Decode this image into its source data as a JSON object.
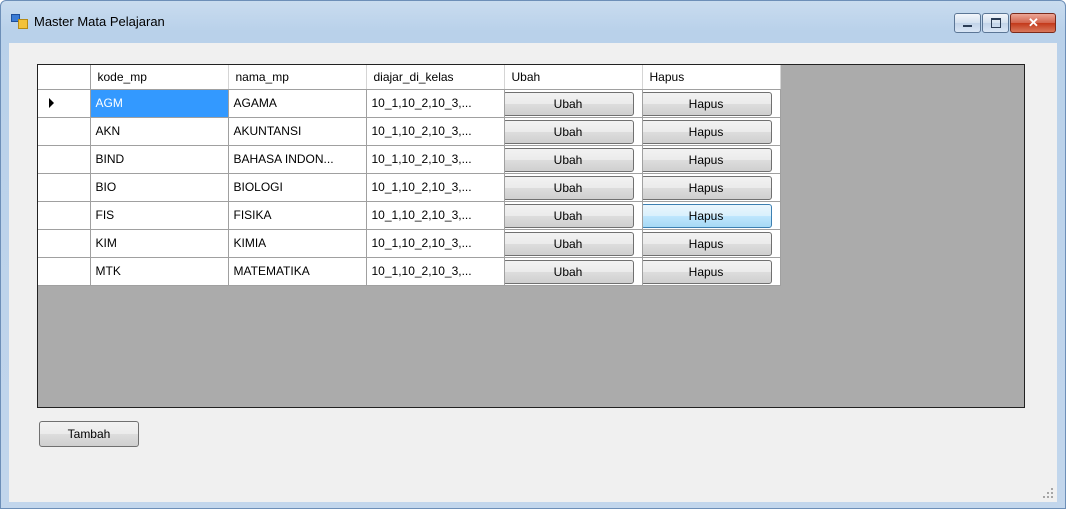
{
  "window": {
    "title": "Master Mata Pelajaran"
  },
  "grid": {
    "columns": [
      "kode_mp",
      "nama_mp",
      "diajar_di_kelas",
      "Ubah",
      "Hapus"
    ],
    "rows": [
      {
        "kode_mp": "AGM",
        "nama_mp": "AGAMA",
        "diajar_di_kelas": "10_1,10_2,10_3,...",
        "ubah": "Ubah",
        "hapus": "Hapus"
      },
      {
        "kode_mp": "AKN",
        "nama_mp": "AKUNTANSI",
        "diajar_di_kelas": "10_1,10_2,10_3,...",
        "ubah": "Ubah",
        "hapus": "Hapus"
      },
      {
        "kode_mp": "BIND",
        "nama_mp": "BAHASA INDON...",
        "diajar_di_kelas": "10_1,10_2,10_3,...",
        "ubah": "Ubah",
        "hapus": "Hapus"
      },
      {
        "kode_mp": "BIO",
        "nama_mp": "BIOLOGI",
        "diajar_di_kelas": "10_1,10_2,10_3,...",
        "ubah": "Ubah",
        "hapus": "Hapus"
      },
      {
        "kode_mp": "FIS",
        "nama_mp": "FISIKA",
        "diajar_di_kelas": "10_1,10_2,10_3,...",
        "ubah": "Ubah",
        "hapus": "Hapus"
      },
      {
        "kode_mp": "KIM",
        "nama_mp": "KIMIA",
        "diajar_di_kelas": "10_1,10_2,10_3,...",
        "ubah": "Ubah",
        "hapus": "Hapus"
      },
      {
        "kode_mp": "MTK",
        "nama_mp": "MATEMATIKA",
        "diajar_di_kelas": "10_1,10_2,10_3,...",
        "ubah": "Ubah",
        "hapus": "Hapus"
      }
    ],
    "current_row_indicator": "triangle-right-icon",
    "selection_color": "#3399ff"
  },
  "buttons": {
    "tambah": "Tambah"
  },
  "titlebar_controls": [
    "minimize-icon",
    "maximize-icon",
    "close-icon"
  ]
}
